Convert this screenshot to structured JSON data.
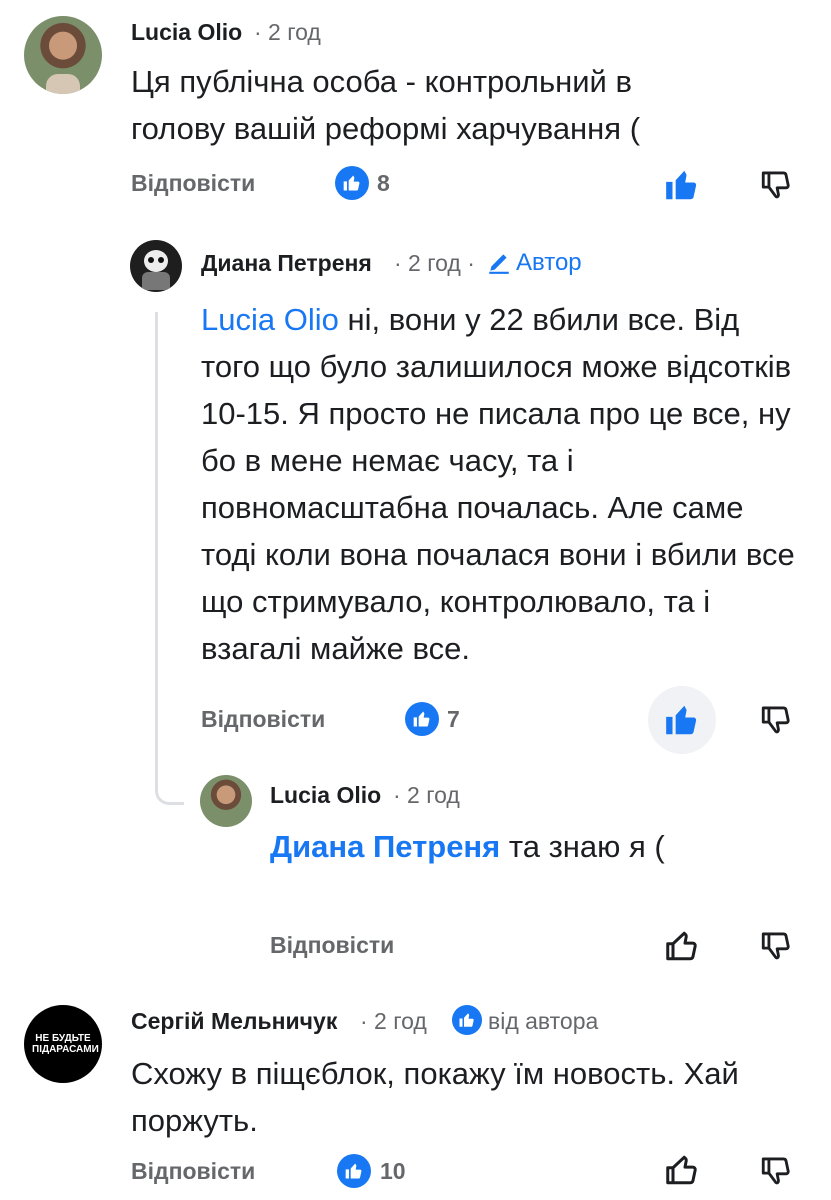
{
  "colors": {
    "link": "#1877f2",
    "muted": "#65676b",
    "text": "#1c1e21",
    "line": "#dddfe2"
  },
  "comments": [
    {
      "author": "Lucia Olio",
      "time": "· 2 год",
      "text": "Ця публічна особа - контрольний в голову вашій реформі харчування (",
      "reply_label": "Відповісти",
      "likes": "8"
    },
    {
      "author": "Диана Петреня",
      "time": "· 2 год ·",
      "author_badge": "Автор",
      "mention": "Lucia Olio",
      "text": " ні, вони у 22 вбили все. Від того що було залишилося може відсотків 10-15. Я просто не писала про це все, ну бо в мене немає часу, та і повномасштабна почалась. Але саме тоді коли вона почалася вони і вбили все що стримувало, контролювало, та і взагалі майже все.",
      "reply_label": "Відповісти",
      "likes": "7"
    },
    {
      "author": "Lucia Olio",
      "time": "· 2 год",
      "mention": "Диана Петреня",
      "text": " та знаю я (",
      "reply_label": "Відповісти"
    },
    {
      "author": "Сергій Мельничук",
      "time": "· 2 год",
      "badge": "від автора",
      "avatar_text": "НЕ БУДЬТЕ ПІДАРАСАМИ",
      "text": "Схожу в піщєблок, покажу їм новость. Хай поржуть.",
      "reply_label": "Відповісти",
      "likes": "10"
    }
  ],
  "icons": [
    "like-icon",
    "dislike-icon",
    "pencil-icon",
    "thumbs-up-badge-icon"
  ]
}
